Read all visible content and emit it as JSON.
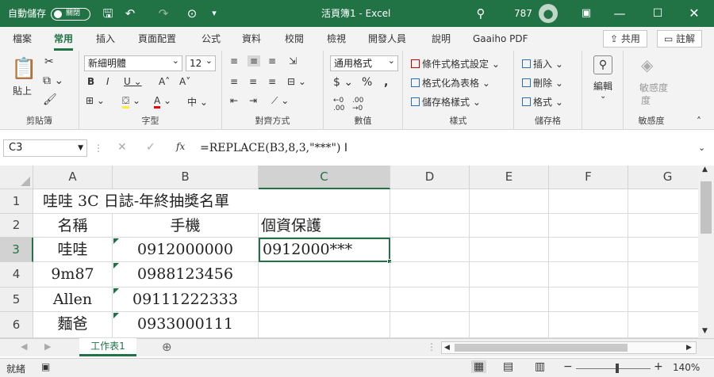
{
  "titlebar": {
    "autosave": "自動儲存",
    "toggle": "關閉",
    "doc": "活頁簿1  -  Excel",
    "user_count": "787"
  },
  "tabs": [
    "檔案",
    "常用",
    "插入",
    "頁面配置",
    "公式",
    "資料",
    "校閱",
    "檢視",
    "開發人員",
    "說明",
    "Gaaiho PDF"
  ],
  "share": "共用",
  "comment": "註解",
  "ribbon": {
    "paste": "貼上",
    "clipboard": "剪貼簿",
    "font_name": "新細明體",
    "font_size": "12",
    "font_group": "字型",
    "align_group": "對齊方式",
    "num_format": "通用格式",
    "num_group": "數值",
    "cond_format": "條件式格式設定",
    "table_format": "格式化為表格",
    "cell_style": "儲存格樣式",
    "styles_group": "樣式",
    "insert": "插入",
    "delete": "刪除",
    "format": "格式",
    "cells_group": "儲存格",
    "edit": "編輯",
    "sensitivity": "敏感度",
    "sens_sub": "度",
    "sens_group": "敏感度"
  },
  "formula_bar": {
    "name_box": "C3",
    "formula": "=REPLACE(B3,8,3,\"***\")"
  },
  "columns": [
    "A",
    "B",
    "C",
    "D",
    "E",
    "F",
    "G"
  ],
  "rows": [
    {
      "num": "1",
      "a": "哇哇 3C 日誌-年終抽獎名單",
      "b": "",
      "c": ""
    },
    {
      "num": "2",
      "a": "名稱",
      "b": "手機",
      "c": "個資保護"
    },
    {
      "num": "3",
      "a": "哇哇",
      "b": "0912000000",
      "c": "0912000***"
    },
    {
      "num": "4",
      "a": "9m87",
      "b": "0988123456",
      "c": ""
    },
    {
      "num": "5",
      "a": "Allen",
      "b": "09111222333",
      "c": ""
    },
    {
      "num": "6",
      "a": "麵爸",
      "b": "0933000111",
      "c": ""
    }
  ],
  "sheet_tab": "工作表1",
  "status": {
    "ready": "就緒",
    "zoom": "140%"
  },
  "colors": {
    "excel_green": "#217346",
    "ribbon_bg": "#f3f3f3"
  }
}
